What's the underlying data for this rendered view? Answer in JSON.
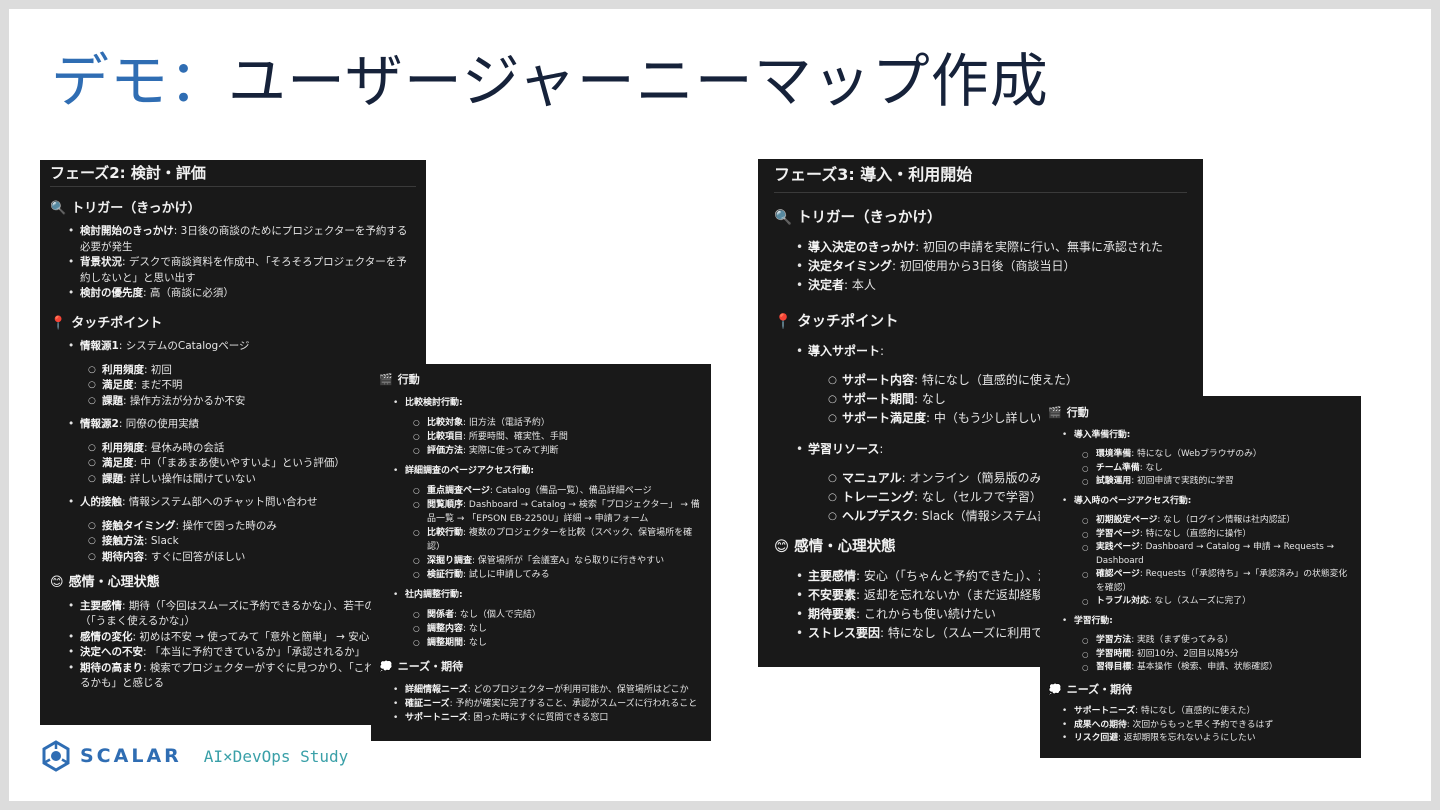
{
  "slide": {
    "title_accent": "デモ：",
    "title_main": "ユーザージャーニーマップ作成"
  },
  "phase2": {
    "heading": "フェーズ2: 検討・評価",
    "trigger": {
      "title": "トリガー（きっかけ）",
      "items": [
        {
          "label": "検討開始のきっかけ",
          "text": ": 3日後の商談のためにプロジェクターを予約する必要が発生"
        },
        {
          "label": "背景状況",
          "text": ": デスクで商談資料を作成中、「そろそろプロジェクターを予約しないと」と思い出す"
        },
        {
          "label": "検討の優先度",
          "text": ": 高（商談に必須）"
        }
      ]
    },
    "touchpoint": {
      "title": "タッチポイント",
      "groups": [
        {
          "label": "情報源1",
          "text": ": システムのCatalogページ",
          "subs": [
            {
              "label": "利用頻度",
              "text": ": 初回"
            },
            {
              "label": "満足度",
              "text": ": まだ不明"
            },
            {
              "label": "課題",
              "text": ": 操作方法が分かるか不安"
            }
          ]
        },
        {
          "label": "情報源2",
          "text": ": 同僚の使用実績",
          "subs": [
            {
              "label": "利用頻度",
              "text": ": 昼休み時の会話"
            },
            {
              "label": "満足度",
              "text": ": 中（「まあまあ使いやすいよ」という評価）"
            },
            {
              "label": "課題",
              "text": ": 詳しい操作は聞けていない"
            }
          ]
        },
        {
          "label": "人的接触",
          "text": ": 情報システム部へのチャット問い合わせ",
          "subs": [
            {
              "label": "接触タイミング",
              "text": ": 操作で困った時のみ"
            },
            {
              "label": "接触方法",
              "text": ": Slack"
            },
            {
              "label": "期待内容",
              "text": ": すぐに回答がほしい"
            }
          ]
        }
      ]
    },
    "emotion": {
      "title": "感情・心理状態",
      "items": [
        {
          "label": "主要感情",
          "text": ": 期待（「今回はスムーズに予約できるかな」）、若干の不安（「うまく使えるかな」）"
        },
        {
          "label": "感情の変化",
          "text": ": 初めは不安 → 使ってみて「意外と簡単」 → 安心"
        },
        {
          "label": "決定への不安",
          "text": ": 「本当に予約できているか」「承認されるか」"
        },
        {
          "label": "期待の高まり",
          "text": ": 検索でプロジェクターがすぐに見つかり、「これは使えるかも」と感じる"
        }
      ]
    }
  },
  "phase2_action": {
    "action_title": "行動",
    "groups": [
      {
        "label": "比較検討行動",
        "subs": [
          {
            "label": "比較対象",
            "text": ": 旧方法（電話予約）"
          },
          {
            "label": "比較項目",
            "text": ": 所要時間、確実性、手間"
          },
          {
            "label": "評価方法",
            "text": ": 実際に使ってみて判断"
          }
        ]
      },
      {
        "label": "詳細調査のページアクセス行動",
        "subs": [
          {
            "label": "重点調査ページ",
            "text": ": Catalog（備品一覧）、備品詳細ページ"
          },
          {
            "label": "閲覧順序",
            "text": ": Dashboard → Catalog → 検索「プロジェクター」 → 備品一覧 → 「EPSON EB-2250U」詳細 → 申請フォーム"
          },
          {
            "label": "比較行動",
            "text": ": 複数のプロジェクターを比較（スペック、保管場所を確認）"
          },
          {
            "label": "深掘り調査",
            "text": ": 保管場所が「会議室A」なら取りに行きやすい"
          },
          {
            "label": "検証行動",
            "text": ": 試しに申請してみる"
          }
        ]
      },
      {
        "label": "社内調整行動",
        "subs": [
          {
            "label": "関係者",
            "text": ": なし（個人で完結）"
          },
          {
            "label": "調整内容",
            "text": ": なし"
          },
          {
            "label": "調整期間",
            "text": ": なし"
          }
        ]
      }
    ],
    "needs_title": "ニーズ・期待",
    "needs": [
      {
        "label": "詳細情報ニーズ",
        "text": ": どのプロジェクターが利用可能か、保管場所はどこか"
      },
      {
        "label": "確証ニーズ",
        "text": ": 予約が確実に完了すること、承認がスムーズに行われること"
      },
      {
        "label": "サポートニーズ",
        "text": ": 困った時にすぐに質問できる窓口"
      }
    ]
  },
  "phase3": {
    "heading": "フェーズ3: 導入・利用開始",
    "trigger": {
      "title": "トリガー（きっかけ）",
      "items": [
        {
          "label": "導入決定のきっかけ",
          "text": ": 初回の申請を実際に行い、無事に承認された"
        },
        {
          "label": "決定タイミング",
          "text": ": 初回使用から3日後（商談当日）"
        },
        {
          "label": "決定者",
          "text": ": 本人"
        }
      ]
    },
    "touchpoint": {
      "title": "タッチポイント",
      "groups": [
        {
          "label": "導入サポート",
          "text": ":",
          "subs": [
            {
              "label": "サポート内容",
              "text": ": 特になし（直感的に使えた）"
            },
            {
              "label": "サポート期間",
              "text": ": なし"
            },
            {
              "label": "サポート満足度",
              "text": ": 中（もう少し詳しいマニュアルがほしい）"
            }
          ]
        },
        {
          "label": "学習リソース",
          "text": ":",
          "subs": [
            {
              "label": "マニュアル",
              "text": ": オンライン（簡易版のみ）"
            },
            {
              "label": "トレーニング",
              "text": ": なし（セルフで学習）"
            },
            {
              "label": "ヘルプデスク",
              "text": ": Slack（情報システム部）"
            }
          ]
        }
      ]
    },
    "emotion": {
      "title": "感情・心理状態",
      "items": [
        {
          "label": "主要感情",
          "text": ": 安心（「ちゃんと予約できた」）、満足"
        },
        {
          "label": "不安要素",
          "text": ": 返却を忘れないか（まだ返却経験なし）"
        },
        {
          "label": "期待要素",
          "text": ": これからも使い続けたい"
        },
        {
          "label": "ストレス要因",
          "text": ": 特になし（スムーズに利用できた）"
        }
      ]
    }
  },
  "phase3_action": {
    "action_title": "行動",
    "groups": [
      {
        "label": "導入準備行動",
        "subs": [
          {
            "label": "環境準備",
            "text": ": 特になし（Webブラウザのみ）"
          },
          {
            "label": "チーム準備",
            "text": ": なし"
          },
          {
            "label": "試験運用",
            "text": ": 初回申請で実践的に学習"
          }
        ]
      },
      {
        "label": "導入時のページアクセス行動",
        "subs": [
          {
            "label": "初期設定ページ",
            "text": ": なし（ログイン情報は社内認証）"
          },
          {
            "label": "学習ページ",
            "text": ": 特になし（直感的に操作）"
          },
          {
            "label": "実践ページ",
            "text": ": Dashboard → Catalog → 申請 → Requests → Dashboard"
          },
          {
            "label": "確認ページ",
            "text": ": Requests（「承認待ち」→「承認済み」の状態変化を確認）"
          },
          {
            "label": "トラブル対応",
            "text": ": なし（スムーズに完了）"
          }
        ]
      },
      {
        "label": "学習行動",
        "subs": [
          {
            "label": "学習方法",
            "text": ": 実践（まず使ってみる）"
          },
          {
            "label": "学習時間",
            "text": ": 初回10分、2回目以降5分"
          },
          {
            "label": "習得目標",
            "text": ": 基本操作（検索、申請、状態確認）"
          }
        ]
      }
    ],
    "needs_title": "ニーズ・期待",
    "needs": [
      {
        "label": "サポートニーズ",
        "text": ": 特になし（直感的に使えた）"
      },
      {
        "label": "成果への期待",
        "text": ": 次回からもっと早く予約できるはず"
      },
      {
        "label": "リスク回避",
        "text": ": 返却期限を忘れないようにしたい"
      }
    ]
  },
  "footer": {
    "brand": "SCALAR",
    "study": "AI×DevOps Study"
  },
  "icons": {
    "trigger": "magnifier-icon",
    "touchpoint": "pushpin-icon",
    "emotion": "smile-icon",
    "action": "clapper-icon",
    "needs": "thought-bubble-icon"
  }
}
